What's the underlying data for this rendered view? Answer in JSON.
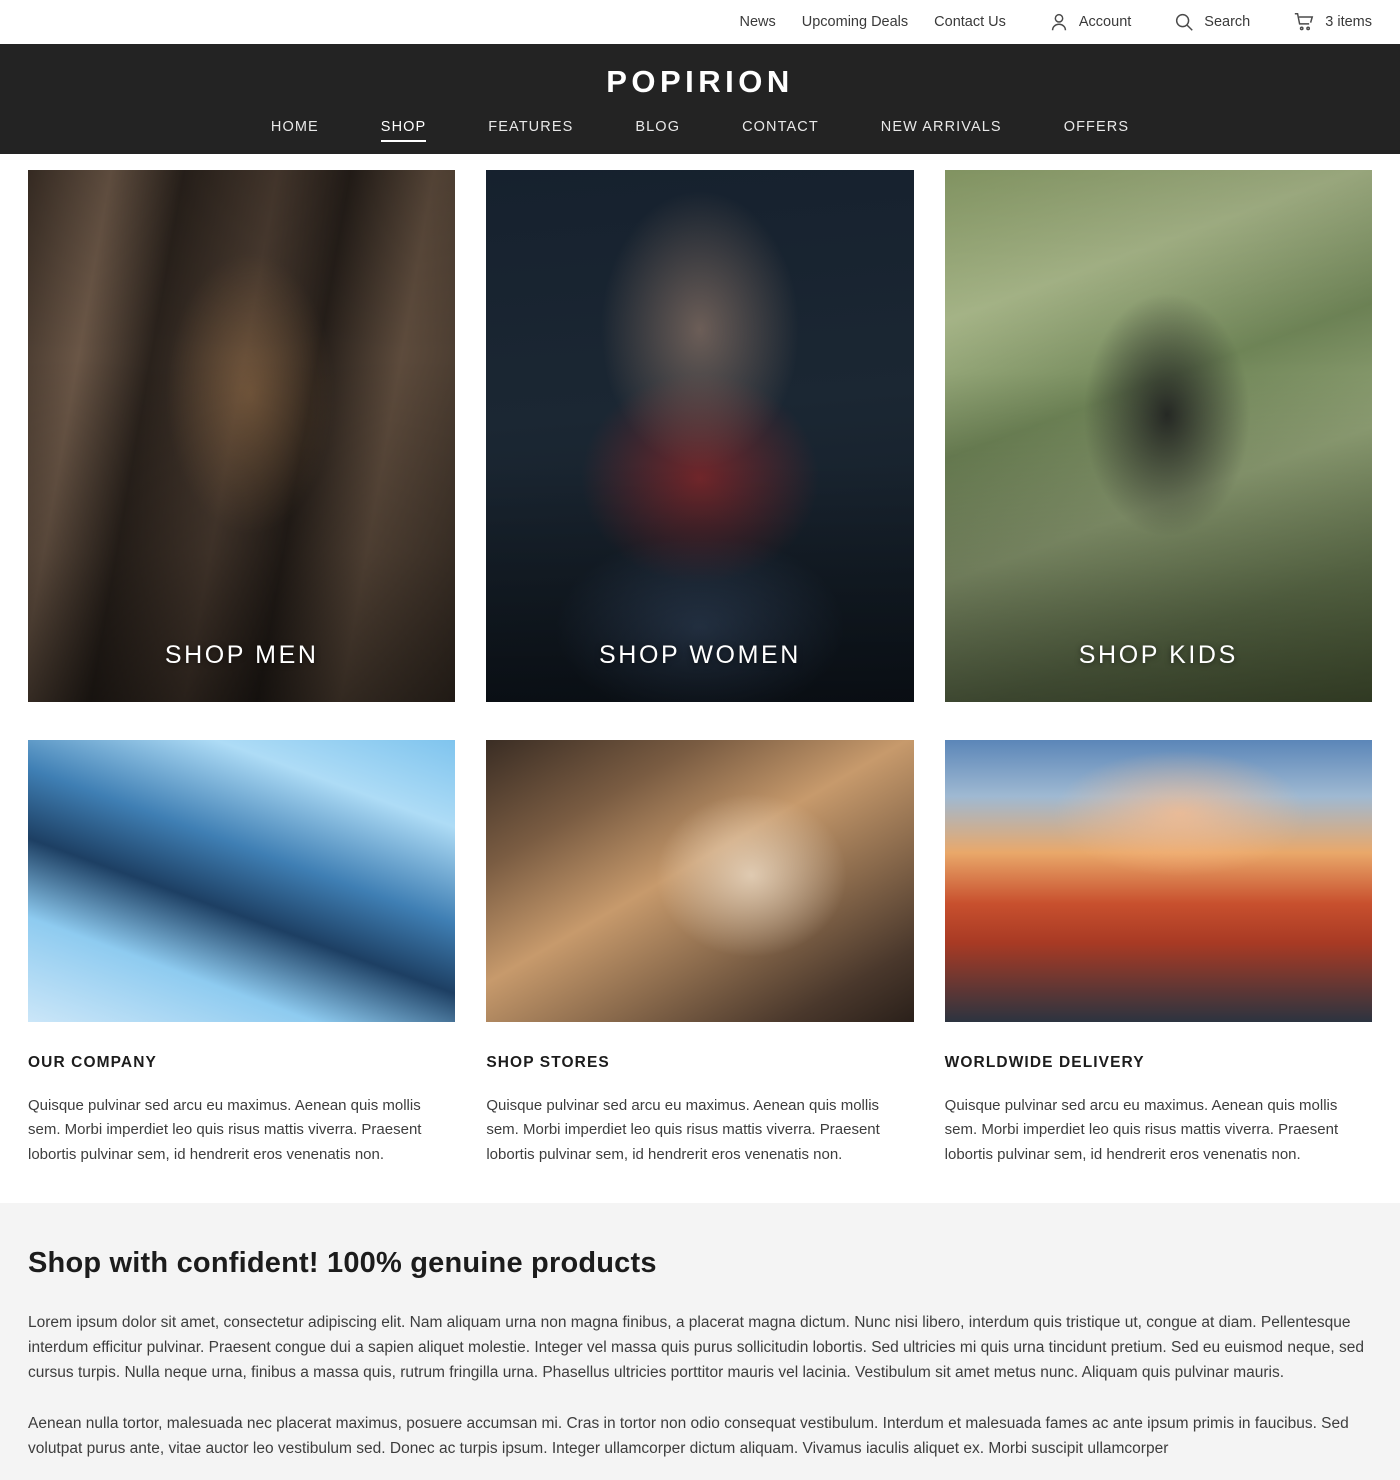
{
  "utility_bar": {
    "links": [
      {
        "label": "News"
      },
      {
        "label": "Upcoming Deals"
      },
      {
        "label": "Contact Us"
      }
    ],
    "account": {
      "icon": "person-icon",
      "label": "Account"
    },
    "search": {
      "icon": "search-icon",
      "label": "Search"
    },
    "cart": {
      "icon": "cart-icon",
      "label": "3 items"
    }
  },
  "header": {
    "brand": "POPIRION",
    "background_color": "#232323",
    "nav": [
      {
        "label": "HOME",
        "active": false
      },
      {
        "label": "SHOP",
        "active": true
      },
      {
        "label": "FEATURES",
        "active": false
      },
      {
        "label": "BLOG",
        "active": false
      },
      {
        "label": "CONTACT",
        "active": false
      },
      {
        "label": "NEW ARRIVALS",
        "active": false
      },
      {
        "label": "OFFERS",
        "active": false
      }
    ]
  },
  "categories": [
    {
      "label": "SHOP MEN"
    },
    {
      "label": "SHOP WOMEN"
    },
    {
      "label": "SHOP KIDS"
    }
  ],
  "features": [
    {
      "title": "OUR COMPANY",
      "body": "Quisque pulvinar sed arcu eu maximus. Aenean quis mollis sem. Morbi imperdiet leo quis risus mattis viverra. Praesent lobortis pulvinar sem, id hendrerit eros venenatis non."
    },
    {
      "title": "SHOP STORES",
      "body": "Quisque pulvinar sed arcu eu maximus. Aenean quis mollis sem. Morbi imperdiet leo quis risus mattis viverra. Praesent lobortis pulvinar sem, id hendrerit eros venenatis non."
    },
    {
      "title": "WORLDWIDE DELIVERY",
      "body": "Quisque pulvinar sed arcu eu maximus. Aenean quis mollis sem. Morbi imperdiet leo quis risus mattis viverra. Praesent lobortis pulvinar sem, id hendrerit eros venenatis non."
    }
  ],
  "promo": {
    "background_color": "#f4f4f4",
    "title": "Shop with confident! 100% genuine products",
    "paragraph_1": "Lorem ipsum dolor sit amet, consectetur adipiscing elit. Nam aliquam urna non magna finibus, a placerat magna dictum. Nunc nisi libero, interdum quis tristique ut, congue at diam. Pellentesque interdum efficitur pulvinar. Praesent congue dui a sapien aliquet molestie. Integer vel massa quis purus sollicitudin lobortis. Sed ultricies mi quis urna tincidunt pretium. Sed eu euismod neque, sed cursus turpis. Nulla neque urna, finibus a massa quis, rutrum fringilla urna. Phasellus ultricies porttitor mauris vel lacinia. Vestibulum sit amet metus nunc. Aliquam quis pulvinar mauris.",
    "paragraph_2": "Aenean nulla tortor, malesuada nec placerat maximus, posuere accumsan mi. Cras in tortor non odio consequat vestibulum. Interdum et malesuada fames ac ante ipsum primis in faucibus. Sed volutpat purus ante, vitae auctor leo vestibulum sed. Donec ac turpis ipsum. Integer ullamcorper dictum aliquam. Vivamus iaculis aliquet ex. Morbi suscipit ullamcorper"
  }
}
